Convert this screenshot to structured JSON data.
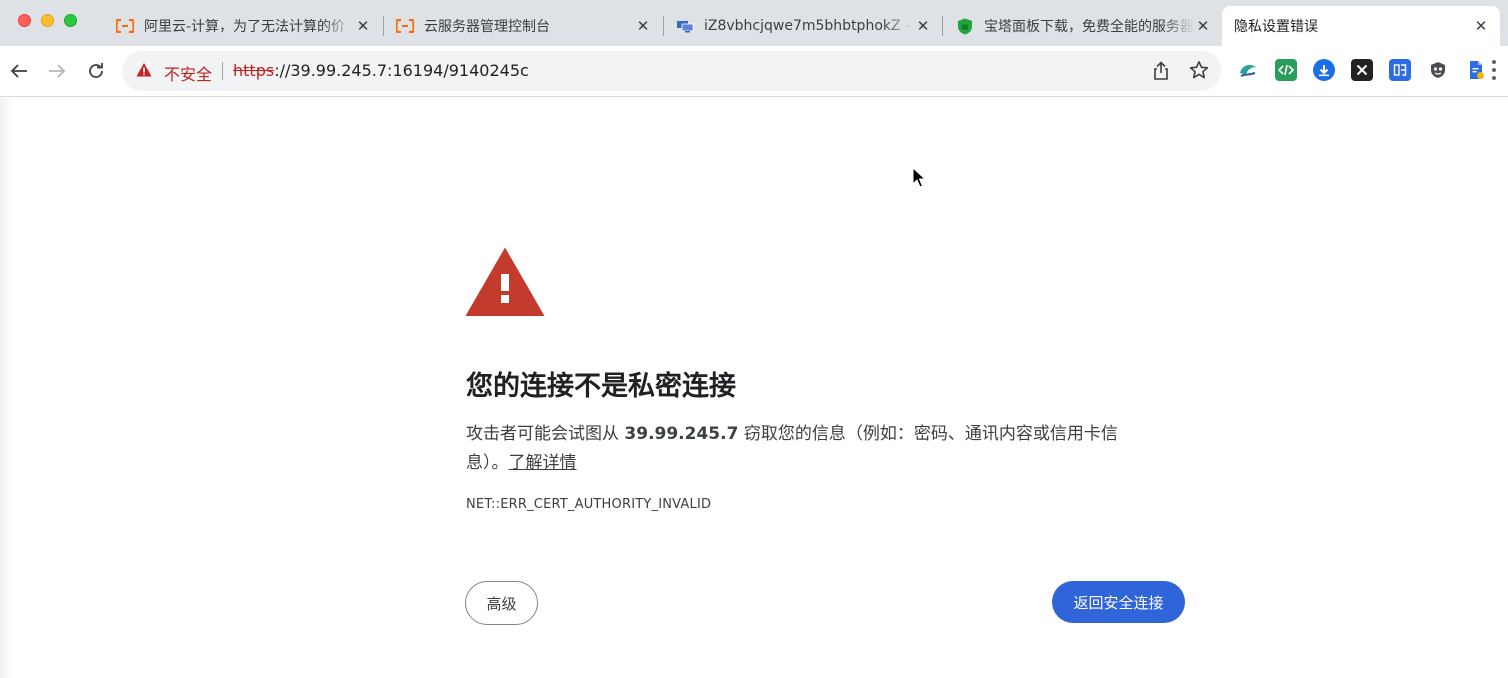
{
  "colors": {
    "tabstrip_bg": "#dee1e6",
    "danger": "#c5221f",
    "warning_triangle": "#c23b2d",
    "primary_button": "#2f65d9"
  },
  "tabs": [
    {
      "title": "阿里云-计算，为了无法计算的价",
      "favicon": "aliyun-icon",
      "active": false
    },
    {
      "title": "云服务器管理控制台",
      "favicon": "aliyun-icon",
      "active": false
    },
    {
      "title": "iZ8vbhcjqwe7m5bhbtphokZ - ",
      "favicon": "remote-desktop-icon",
      "active": false
    },
    {
      "title": "宝塔面板下载，免费全能的服务器",
      "favicon": "bt-panel-icon",
      "active": false
    },
    {
      "title": "隐私设置错误",
      "favicon": "none",
      "active": true
    }
  ],
  "toolbar": {
    "security_label": "不安全",
    "url_scheme": "https",
    "url_rest": "://39.99.245.7:16194/9140245c",
    "extensions": [
      "weather-extension-icon",
      "code-extension-icon",
      "cloud-download-extension-icon",
      "x-extension-icon",
      "shopping-extension-icon",
      "mask-extension-icon",
      "file-extension-icon"
    ]
  },
  "interstitial": {
    "heading": "您的连接不是私密连接",
    "message_prefix": "攻击者可能会试图从 ",
    "message_host": "39.99.245.7",
    "message_suffix": " 窃取您的信息（例如：密码、通讯内容或信用卡信息）。",
    "learn_more": "了解详情",
    "error_code": "NET::ERR_CERT_AUTHORITY_INVALID",
    "advanced_button": "高级",
    "back_button": "返回安全连接"
  }
}
